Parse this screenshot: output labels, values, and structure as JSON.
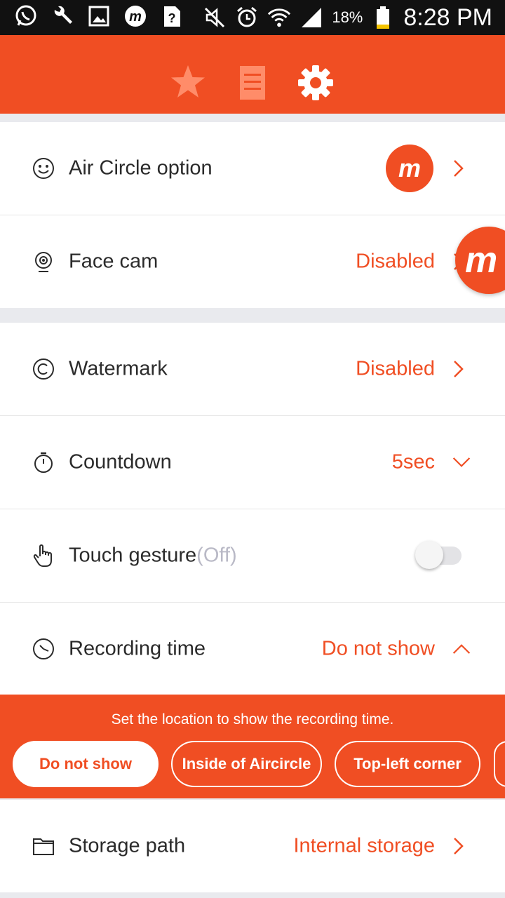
{
  "statusbar": {
    "battery_percent": "18%",
    "time": "8:28 PM",
    "icons": [
      "whatsapp-icon",
      "wrench-icon",
      "image-icon",
      "mobizen-icon",
      "unknown-file-icon",
      "mute-icon",
      "alarm-icon",
      "wifi-icon",
      "signal-icon",
      "battery-icon"
    ]
  },
  "tabs": [
    {
      "name": "favorites",
      "icon": "star-icon"
    },
    {
      "name": "list",
      "icon": "list-icon"
    },
    {
      "name": "settings",
      "icon": "gear-icon"
    }
  ],
  "colors": {
    "accent": "#f04e23",
    "divider": "#e9eaee"
  },
  "settings": {
    "air_circle": {
      "label": "Air Circle option",
      "logo_letter": "m"
    },
    "face_cam": {
      "label": "Face cam",
      "value": "Disabled"
    },
    "watermark": {
      "label": "Watermark",
      "value": "Disabled"
    },
    "countdown": {
      "label": "Countdown",
      "value": "5sec"
    },
    "touch_gesture": {
      "label": "Touch gesture",
      "status": "(Off)",
      "enabled": false
    },
    "recording_time": {
      "label": "Recording time",
      "value": "Do not show",
      "panel_text": "Set the location to show the recording time.",
      "options": [
        "Do not show",
        "Inside of Aircircle",
        "Top-left corner"
      ],
      "selected": "Do not show"
    },
    "storage_path": {
      "label": "Storage path",
      "value": "Internal storage"
    }
  },
  "floating_button": {
    "letter": "m"
  }
}
